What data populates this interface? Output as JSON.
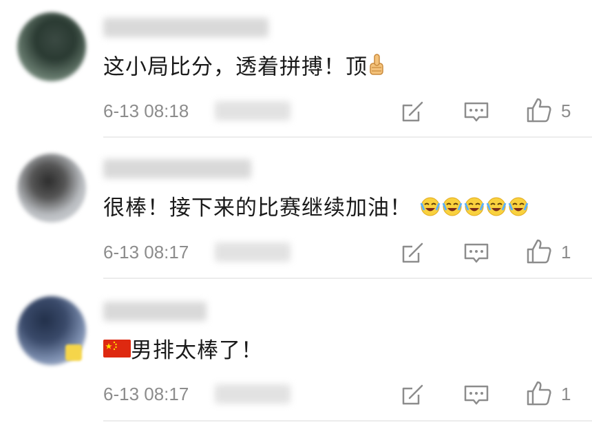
{
  "comments": [
    {
      "text": "这小局比分，透着拼搏！顶",
      "timestamp": "6-13 08:18",
      "likes": "5",
      "emoji_icons": [
        "thumbs-up-emoji-icon"
      ]
    },
    {
      "text": "很棒！接下来的比赛继续加油！",
      "timestamp": "6-13 08:17",
      "likes": "1",
      "emoji_icons": [
        "crying-laughing-emoji-icon",
        "crying-laughing-emoji-icon",
        "crying-laughing-emoji-icon",
        "crying-laughing-emoji-icon",
        "crying-laughing-emoji-icon"
      ]
    },
    {
      "text": "男排太棒了！",
      "timestamp": "6-13 08:17",
      "likes": "1",
      "emoji_icons": [
        "china-flag-emoji-icon"
      ]
    }
  ],
  "colors": {
    "text": "#1a1a1a",
    "meta": "#8c8c8c",
    "icon": "#8c8c8c",
    "divider": "#ececec",
    "blur": "#d9d9d9"
  }
}
